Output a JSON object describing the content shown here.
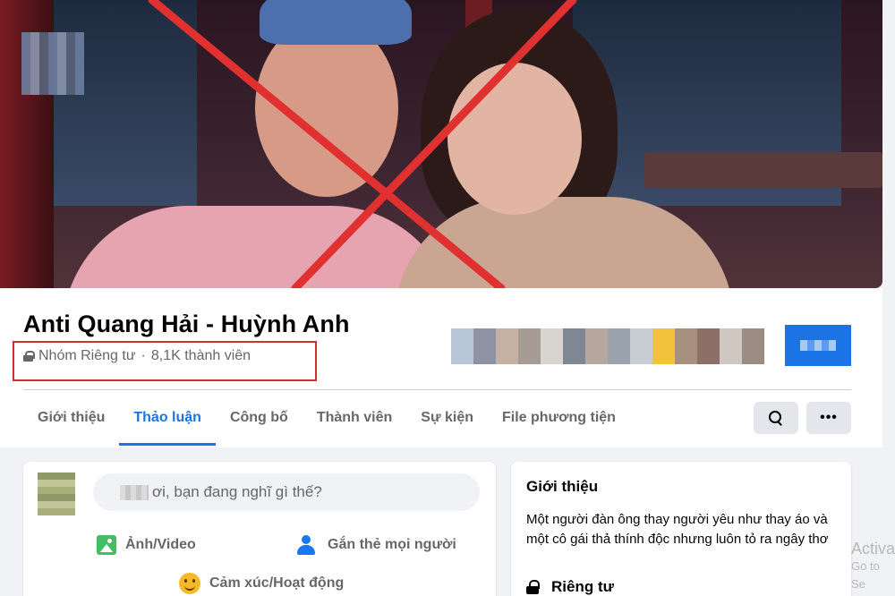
{
  "group": {
    "title": "Anti Quang Hải - Huỳnh Anh",
    "privacy_label": "Nhóm Riêng tư",
    "separator": "·",
    "member_count": "8,1K thành viên"
  },
  "tabs": [
    {
      "label": "Giới thiệu"
    },
    {
      "label": "Thảo luận",
      "active": true
    },
    {
      "label": "Công bố"
    },
    {
      "label": "Thành viên"
    },
    {
      "label": "Sự kiện"
    },
    {
      "label": "File phương tiện"
    }
  ],
  "toolbar": {
    "search_icon": "search-icon",
    "more_icon": "more-dots-icon",
    "more_glyph": "•••"
  },
  "composer": {
    "placeholder": "ơi, bạn đang nghĩ gì thế?",
    "actions": {
      "photo": "Ảnh/Video",
      "tag": "Gắn thẻ mọi người",
      "feeling": "Cảm xúc/Hoạt động"
    }
  },
  "about": {
    "title": "Giới thiệu",
    "description": "Một người đàn ông thay người yêu như thay áo và một cô gái thả thính độc nhưng luôn tỏ ra ngây thơ",
    "privacy": "Riêng tư"
  },
  "watermark": {
    "line1": "Activa",
    "line2": "Go to Se"
  },
  "colors": {
    "accent": "#1b74e4",
    "highlight_box": "#d0302f",
    "cross_mark": "#e03030"
  }
}
